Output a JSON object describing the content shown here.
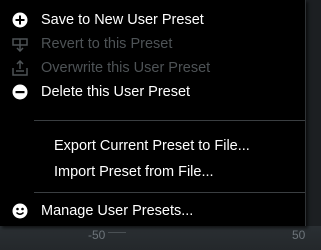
{
  "menu": {
    "items": [
      {
        "label": "Save to New User Preset",
        "icon": "plus-circle-icon",
        "enabled": true
      },
      {
        "label": "Revert to this Preset",
        "icon": "revert-icon",
        "enabled": false
      },
      {
        "label": "Overwrite this User Preset",
        "icon": "overwrite-icon",
        "enabled": false
      },
      {
        "label": "Delete this User Preset",
        "icon": "minus-circle-icon",
        "enabled": true
      },
      {
        "label": "Export Current Preset to File...",
        "enabled": true
      },
      {
        "label": "Import Preset from File...",
        "enabled": true
      },
      {
        "label": "Manage User Presets...",
        "icon": "smiley-icon",
        "enabled": true
      }
    ]
  },
  "background": {
    "labels": [
      "-50",
      "50"
    ]
  },
  "colors": {
    "menu_bg": "#000000",
    "text": "#ffffff",
    "disabled_text": "#4e5356"
  }
}
